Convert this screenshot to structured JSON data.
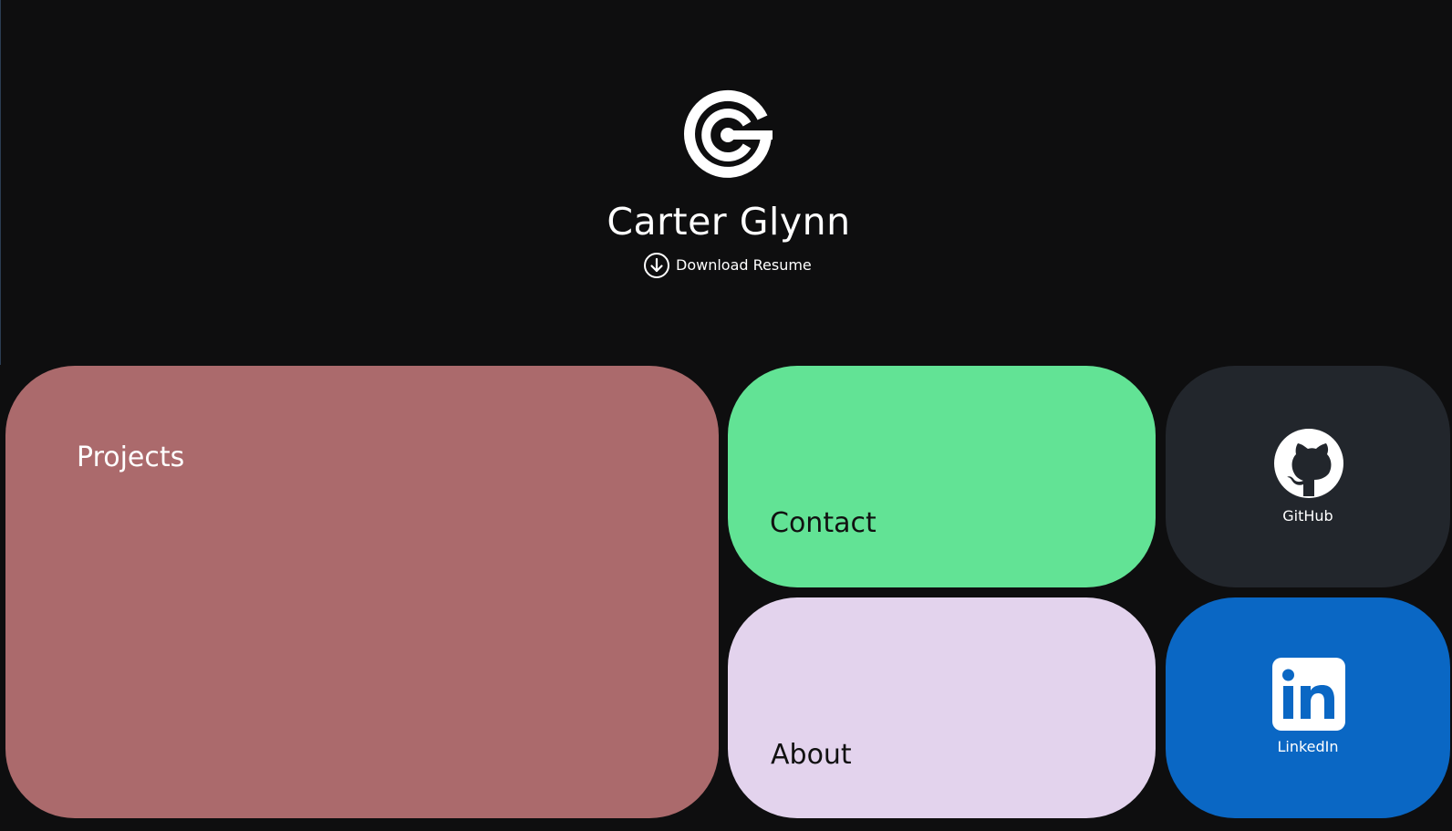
{
  "header": {
    "name": "Carter Glynn",
    "resume_label": "Download Resume",
    "logo_icon": "cg-monogram-logo",
    "resume_icon": "download-circle-icon"
  },
  "tiles": {
    "projects": {
      "label": "Projects",
      "color": "#ab6a6c"
    },
    "contact": {
      "label": "Contact",
      "color": "#62e395"
    },
    "about": {
      "label": "About",
      "color": "#e3d3ed"
    },
    "github": {
      "label": "GitHub",
      "icon": "github-icon",
      "color": "#22262c"
    },
    "linkedin": {
      "label": "LinkedIn",
      "icon": "linkedin-icon",
      "color": "#0a67c4"
    }
  },
  "theme": {
    "background": "#0e0e0f",
    "text_light": "#ffffff",
    "text_dark": "#111111"
  }
}
